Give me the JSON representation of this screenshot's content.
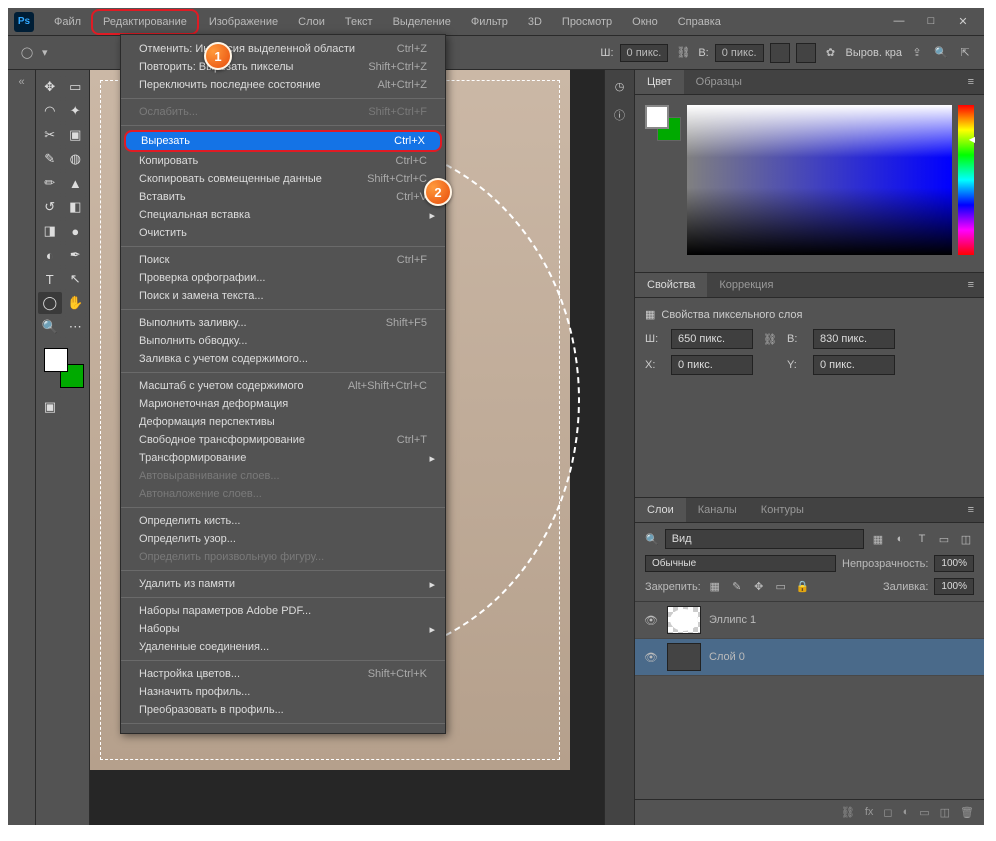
{
  "menubar": {
    "logo": "Ps",
    "items": [
      "Файл",
      "Редактирование",
      "Изображение",
      "Слои",
      "Текст",
      "Выделение",
      "Фильтр",
      "3D",
      "Просмотр",
      "Окно",
      "Справка"
    ]
  },
  "optionsbar": {
    "w_label": "Ш:",
    "w_value": "0 пикс.",
    "h_label": "В:",
    "h_value": "0 пикс.",
    "align_label": "Выров. кра"
  },
  "dropdown": {
    "items": [
      {
        "label": "Отменить: Инверсия выделенной области",
        "shortcut": "Ctrl+Z"
      },
      {
        "label": "Повторить: Вырезать пикселы",
        "shortcut": "Shift+Ctrl+Z"
      },
      {
        "label": "Переключить последнее состояние",
        "shortcut": "Alt+Ctrl+Z"
      },
      {
        "sep": true
      },
      {
        "label": "Ослабить...",
        "shortcut": "Shift+Ctrl+F",
        "disabled": true
      },
      {
        "sep": true
      },
      {
        "label": "Вырезать",
        "shortcut": "Ctrl+X",
        "highlight": true
      },
      {
        "label": "Копировать",
        "shortcut": "Ctrl+C"
      },
      {
        "label": "Скопировать совмещенные данные",
        "shortcut": "Shift+Ctrl+C"
      },
      {
        "label": "Вставить",
        "shortcut": "Ctrl+V"
      },
      {
        "label": "Специальная вставка",
        "sub": true
      },
      {
        "label": "Очистить"
      },
      {
        "sep": true
      },
      {
        "label": "Поиск",
        "shortcut": "Ctrl+F"
      },
      {
        "label": "Проверка орфографии..."
      },
      {
        "label": "Поиск и замена текста..."
      },
      {
        "sep": true
      },
      {
        "label": "Выполнить заливку...",
        "shortcut": "Shift+F5"
      },
      {
        "label": "Выполнить обводку..."
      },
      {
        "label": "Заливка с учетом содержимого..."
      },
      {
        "sep": true
      },
      {
        "label": "Масштаб с учетом содержимого",
        "shortcut": "Alt+Shift+Ctrl+C"
      },
      {
        "label": "Марионеточная деформация"
      },
      {
        "label": "Деформация перспективы"
      },
      {
        "label": "Свободное трансформирование",
        "shortcut": "Ctrl+T"
      },
      {
        "label": "Трансформирование",
        "sub": true
      },
      {
        "label": "Автовыравнивание слоев...",
        "disabled": true
      },
      {
        "label": "Автоналожение слоев...",
        "disabled": true
      },
      {
        "sep": true
      },
      {
        "label": "Определить кисть..."
      },
      {
        "label": "Определить узор..."
      },
      {
        "label": "Определить произвольную фигуру...",
        "disabled": true
      },
      {
        "sep": true
      },
      {
        "label": "Удалить из памяти",
        "sub": true
      },
      {
        "sep": true
      },
      {
        "label": "Наборы параметров Adobe PDF..."
      },
      {
        "label": "Наборы",
        "sub": true
      },
      {
        "label": "Удаленные соединения..."
      },
      {
        "sep": true
      },
      {
        "label": "Настройка цветов...",
        "shortcut": "Shift+Ctrl+K"
      },
      {
        "label": "Назначить профиль..."
      },
      {
        "label": "Преобразовать в профиль..."
      },
      {
        "sep": true
      }
    ]
  },
  "panels": {
    "color_tabs": [
      "Цвет",
      "Образцы"
    ],
    "props_tabs": [
      "Свойства",
      "Коррекция"
    ],
    "props_title": "Свойства пиксельного слоя",
    "props": {
      "w_label": "Ш:",
      "w_value": "650 пикс.",
      "h_label": "В:",
      "h_value": "830 пикс.",
      "x_label": "X:",
      "x_value": "0 пикс.",
      "y_label": "Y:",
      "y_value": "0 пикс."
    },
    "layers_tabs": [
      "Слои",
      "Каналы",
      "Контуры"
    ],
    "layers": {
      "search_label": "Вид",
      "blend_mode": "Обычные",
      "opacity_label": "Непрозрачность:",
      "opacity_value": "100%",
      "lock_label": "Закрепить:",
      "fill_label": "Заливка:",
      "fill_value": "100%",
      "items": [
        {
          "name": "Эллипс 1",
          "selected": false
        },
        {
          "name": "Слой 0",
          "selected": true
        }
      ]
    }
  },
  "markers": {
    "m1": "1",
    "m2": "2"
  }
}
